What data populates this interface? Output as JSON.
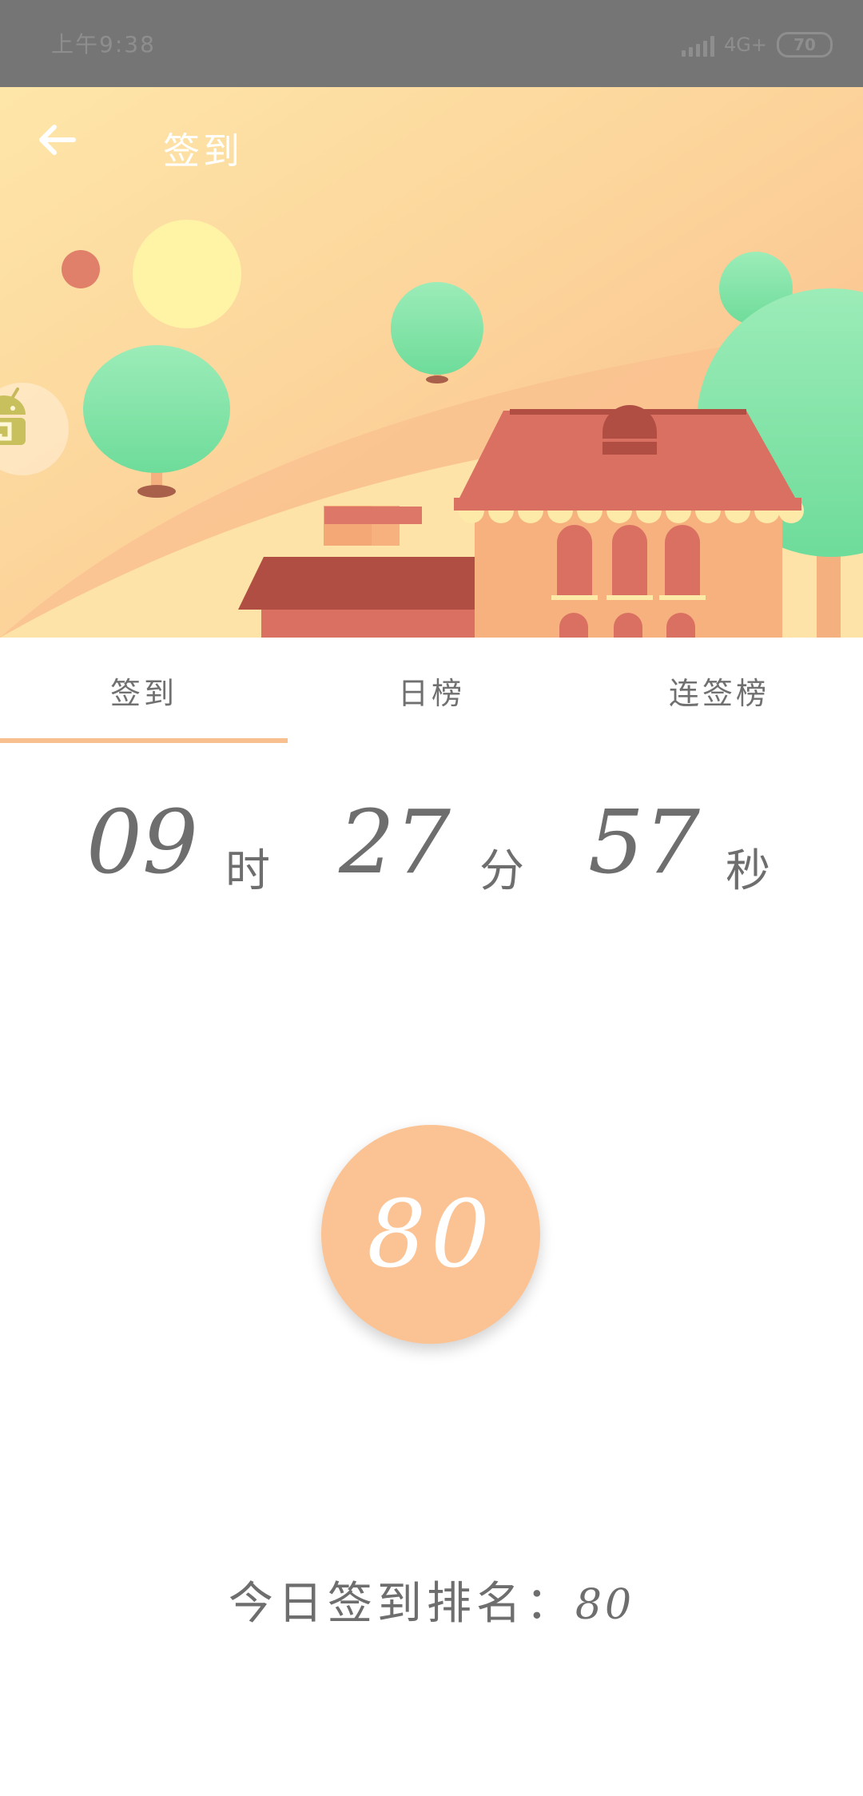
{
  "status_bar": {
    "time": "上午9:38",
    "network": "4G+",
    "battery": "70"
  },
  "header": {
    "title": "签到",
    "back_icon": "arrow-left-icon"
  },
  "tabs": [
    {
      "label": "签到",
      "active": true
    },
    {
      "label": "日榜",
      "active": false
    },
    {
      "label": "连签榜",
      "active": false
    }
  ],
  "countdown": {
    "hours": "09",
    "hours_unit": "时",
    "minutes": "27",
    "minutes_unit": "分",
    "seconds": "57",
    "seconds_unit": "秒"
  },
  "checkin": {
    "value": "80"
  },
  "rank": {
    "label": "今日签到排名：",
    "value": "80"
  },
  "colors": {
    "accent": "#f9c08f",
    "status_bar": "#757575",
    "text_gray": "#6e6e6e",
    "sky": "#fde3a7",
    "roof": "#d97062",
    "tree": "#8ee8b0"
  }
}
